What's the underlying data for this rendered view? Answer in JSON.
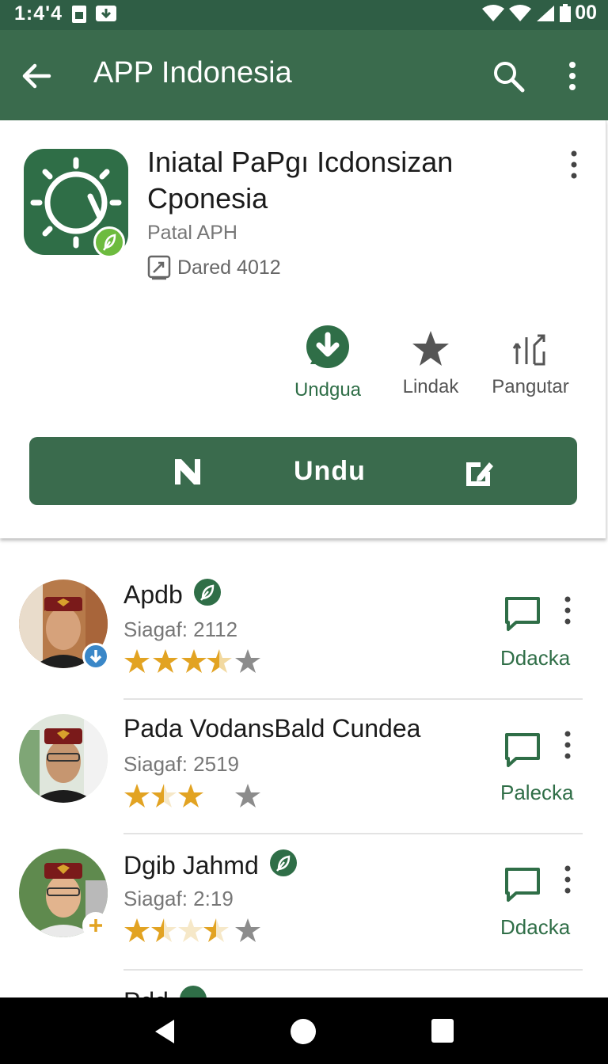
{
  "status_bar": {
    "time": "1:4'4",
    "battery_text": "00"
  },
  "app_bar": {
    "title": "APP Indonesia",
    "back_icon": "arrow-left-icon",
    "search_icon": "search-icon",
    "more_icon": "more-vert-icon"
  },
  "app": {
    "title": "Iniatal PaPgı Icdonsizan Cponesia",
    "publisher": "Patal APH",
    "meta": "Dared 4012",
    "accent": "#2f6e47"
  },
  "actions": [
    {
      "label": "Undgua",
      "icon": "download-icon"
    },
    {
      "label": "Lindak",
      "icon": "star-icon"
    },
    {
      "label": "Pangutar",
      "icon": "share-icon"
    }
  ],
  "install_button": {
    "label": "Undu"
  },
  "list": [
    {
      "name": "Apdb",
      "sub": "Siagaf: 2112",
      "rating": 3.5,
      "action": "Ddacka",
      "verified": true,
      "badge": "download"
    },
    {
      "name": "Pada VodansBald Cundea",
      "sub": "Siagaf: 2519",
      "rating": 2.5,
      "action": "Palecka",
      "verified": false,
      "badge": "none"
    },
    {
      "name": "Dgib Jahmd",
      "sub": "Siagaf: 2:19",
      "rating": 2.5,
      "action": "Ddacka",
      "verified": true,
      "badge": "add"
    },
    {
      "name": "Pdd",
      "sub": "",
      "rating": 0,
      "action": "",
      "verified": true,
      "badge": "none"
    }
  ]
}
